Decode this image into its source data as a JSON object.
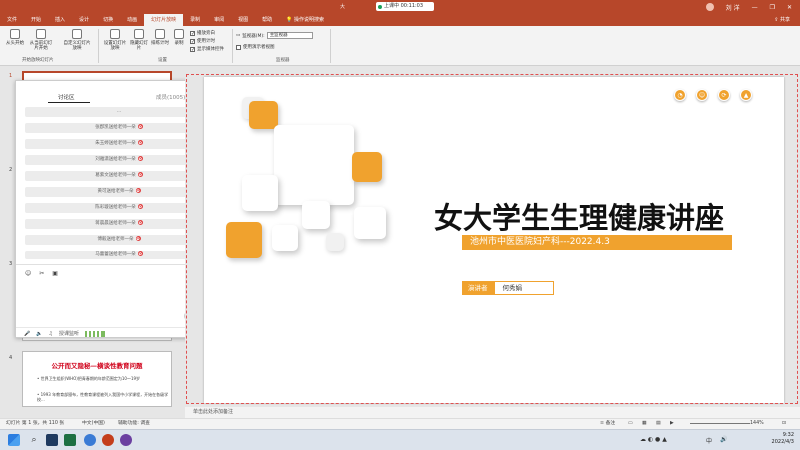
{
  "titlebar": {
    "title": "大",
    "meeting": "上课中 00:11:03",
    "user": "刘 洋"
  },
  "menu": {
    "items": [
      "文件",
      "开始",
      "插入",
      "设计",
      "切换",
      "动画",
      "幻灯片放映",
      "录制",
      "审阅",
      "视图",
      "帮助",
      "操作说明搜索"
    ],
    "share": "共享"
  },
  "ribbon": {
    "btn_from_start": "从头开始",
    "btn_from_current": "从当前幻灯片开始",
    "btn_custom": "自定义幻灯片放映",
    "group_start": "开始放映幻灯片",
    "btn_setup": "设置幻灯片放映",
    "btn_hide": "隐藏幻灯片",
    "btn_rehearse": "排练计时",
    "btn_record": "录制",
    "group_setup": "设置",
    "chk_narration": "播放旁白",
    "chk_timing": "使用计时",
    "chk_media": "显示媒体控件",
    "monitor_label": "监视器(M):",
    "monitor_value": "主监视器",
    "chk_presenter": "使用演示者视图",
    "group_monitor": "监视器"
  },
  "thumbnails": {
    "numbers": [
      "1",
      "2",
      "3",
      "4"
    ],
    "slide4_title": "公开而又隐秘—横谈性教育问题",
    "slide4_b1": "• 世界卫生组织(WHO)把青春期的年龄范围定为10～19岁",
    "slide4_b2": "• 1993 年教育部颁布，性教育课程被列入我国中小学课程，开始在各级学校..."
  },
  "chat": {
    "tab_discuss": "讨论区",
    "tab_members": "成员(1005)",
    "controls": "• ‒ ×",
    "messages": [
      "…",
      "张郡凯送给老师一朵",
      "朱玉婷送给老师一朵",
      "刘雅潇送给老师一朵",
      "葛紫文送给老师一朵",
      "黄可送给老师一朵",
      "陈彩璇送给老师一朵",
      "蒋晨晨送给老师一朵",
      "傅毅送给老师一朵",
      "马蕾蕾送给老师一朵"
    ],
    "send": "发 送",
    "voice_label": "授课监听"
  },
  "slide": {
    "title": "女大学生生理健康讲座",
    "subtitle": "池州市中医医院妇产科---2022.4.3",
    "speaker_label": "演讲者",
    "speaker_name": "何秀娟"
  },
  "notes": {
    "placeholder": "单击此处添加备注"
  },
  "status": {
    "slide_info": "幻灯片 第 1 张，共 110 张",
    "language": "中文(中国)",
    "accessibility": "辅助功能: 调查",
    "notes_btn": "备注",
    "zoom": "144%"
  },
  "taskbar": {
    "time": "9:32",
    "date": "2022/4/3",
    "ime": "中"
  },
  "colors": {
    "accent": "#b7472a",
    "orange": "#f0a22e"
  }
}
